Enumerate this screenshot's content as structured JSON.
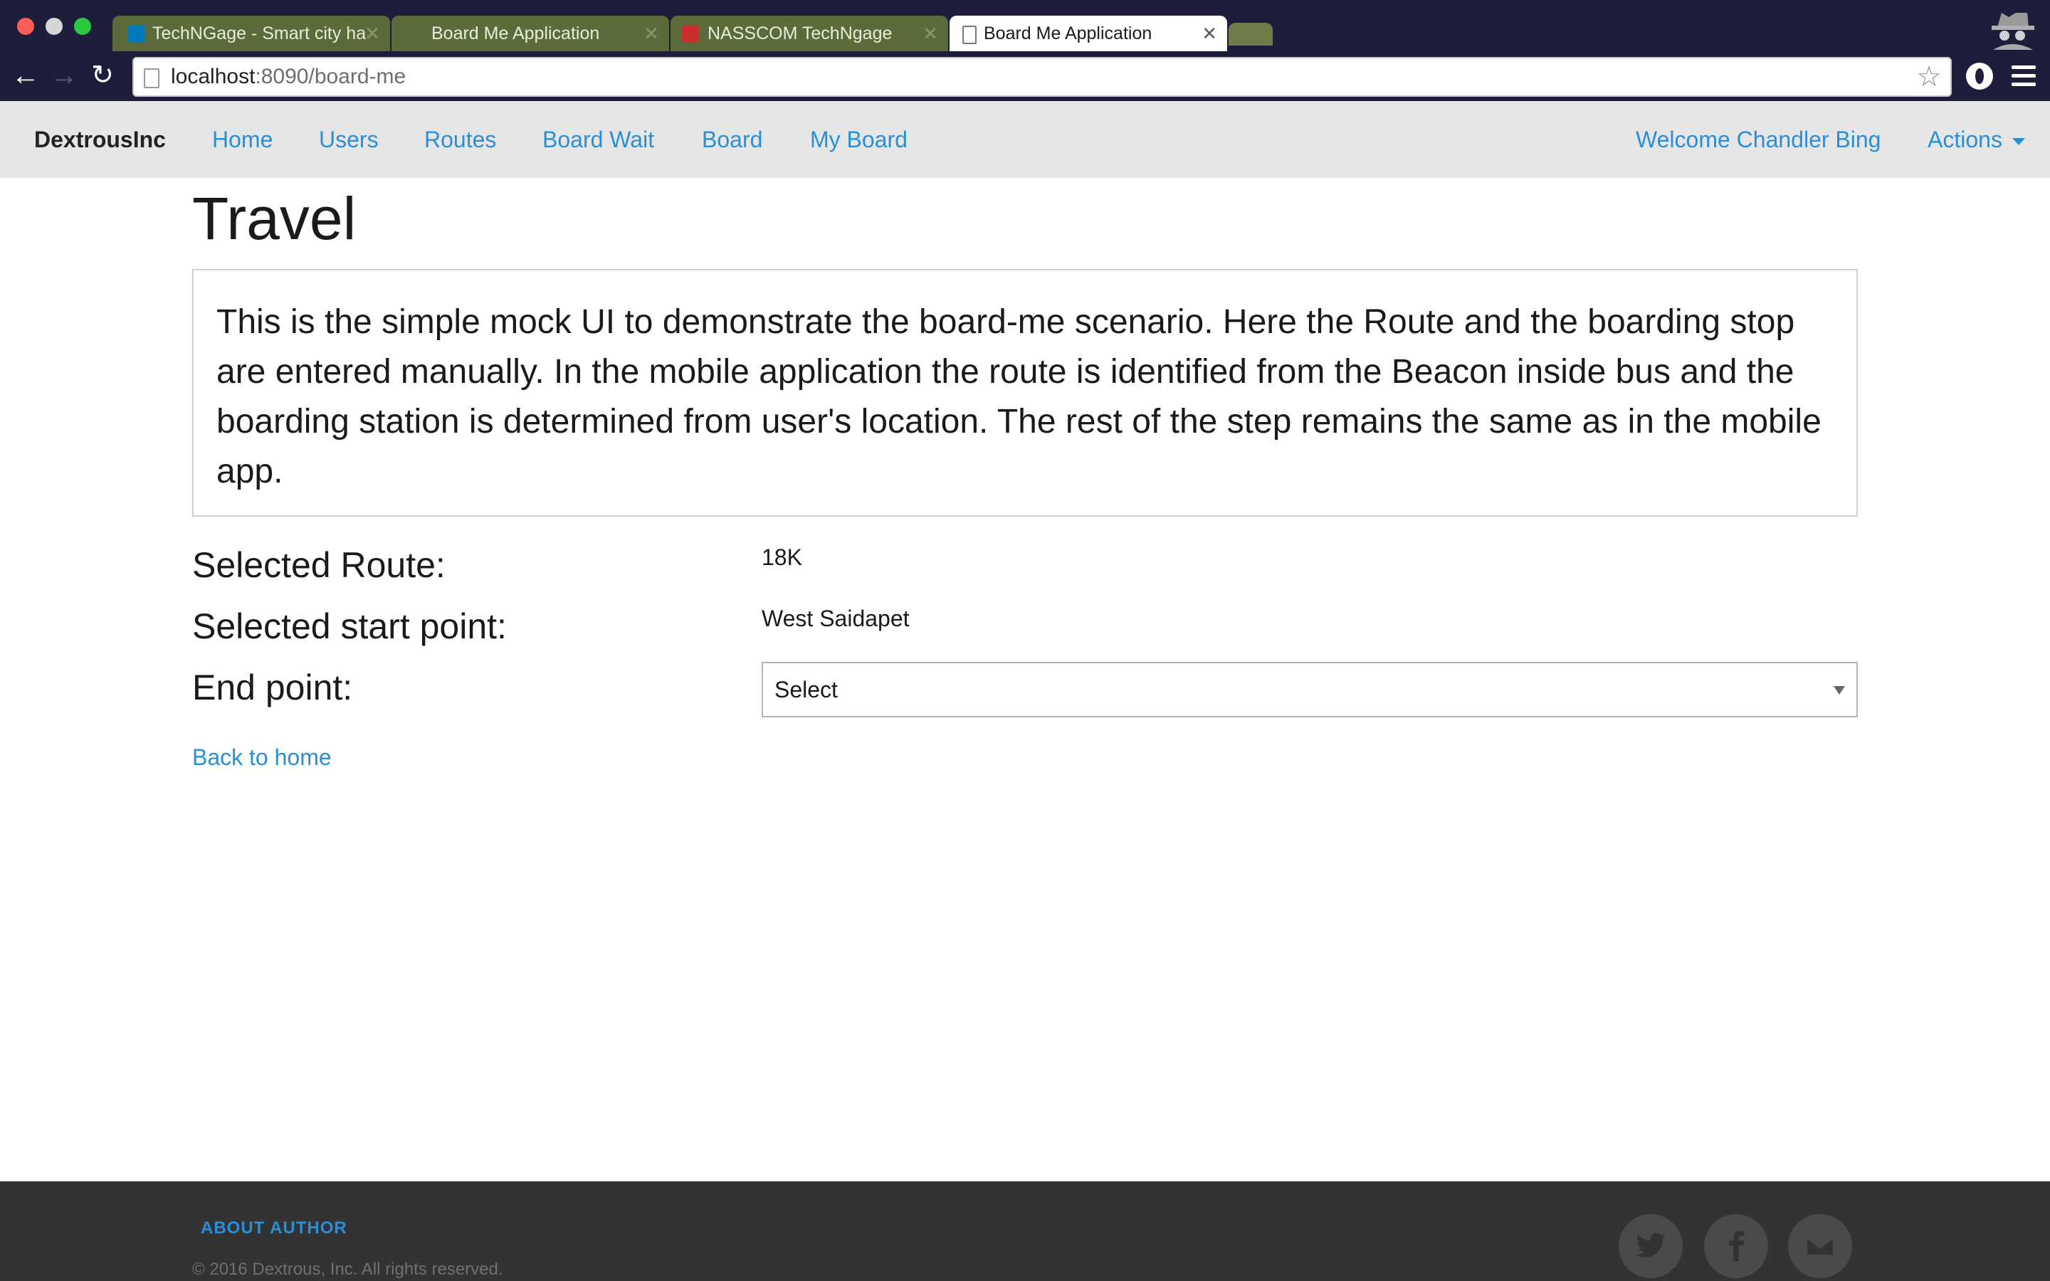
{
  "browser": {
    "tabs": [
      {
        "title": "TechNGage - Smart city ha"
      },
      {
        "title": "Board Me Application"
      },
      {
        "title": "NASSCOM TechNgage"
      },
      {
        "title": "Board Me Application"
      }
    ],
    "url_host": "localhost",
    "url_path": ":8090/board-me",
    "icons": {
      "back": "back-arrow-icon",
      "forward": "forward-arrow-icon",
      "reload": "reload-icon",
      "star": "bookmark-star-icon",
      "menu": "hamburger-menu-icon"
    }
  },
  "navbar": {
    "brand": "DextrousInc",
    "links": [
      {
        "label": "Home"
      },
      {
        "label": "Users"
      },
      {
        "label": "Routes"
      },
      {
        "label": "Board Wait"
      },
      {
        "label": "Board"
      },
      {
        "label": "My Board"
      }
    ],
    "welcome": "Welcome Chandler Bing",
    "actions": "Actions",
    "link_color": "#2a8fd6"
  },
  "main": {
    "title": "Travel",
    "description": "This is the simple mock UI to demonstrate the board-me scenario. Here the Route and the boarding stop are entered manually. In the mobile application the route is identified from the Beacon inside bus and the boarding station is determined from user's location. The rest of the step remains the same as in the mobile app.",
    "route_label": "Selected Route:",
    "route_value": "18K",
    "start_label": "Selected start point:",
    "start_value": "West Saidapet",
    "end_label": "End point:",
    "end_select": "Select",
    "back_link": "Back to home"
  },
  "footer": {
    "about": "ABOUT AUTHOR",
    "copyright": "© 2016 Dextrous, Inc. All rights reserved.",
    "social": [
      "twitter-icon",
      "facebook-icon",
      "mail-icon"
    ]
  }
}
